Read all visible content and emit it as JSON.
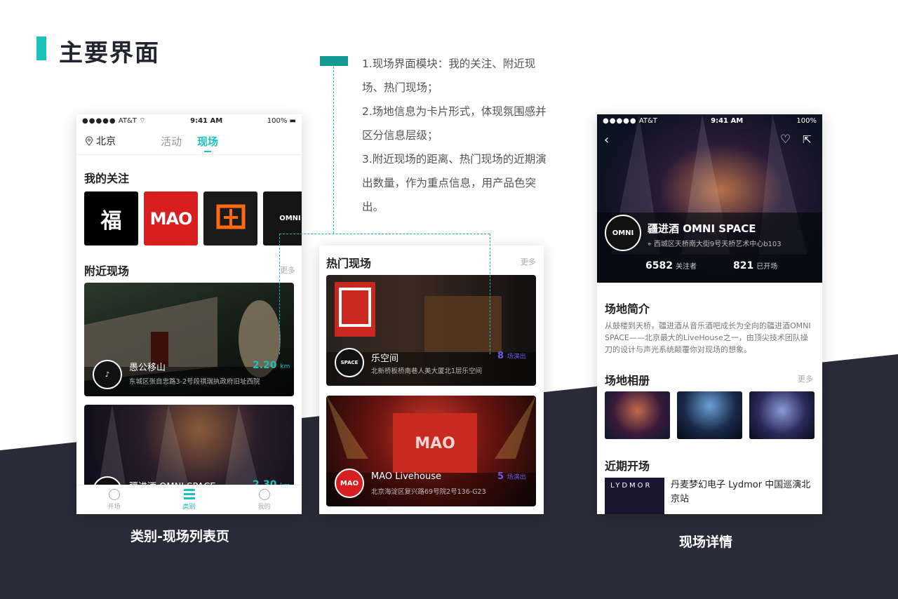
{
  "heading": {
    "title": "主要界面"
  },
  "notes": [
    "1.现场界面模块：我的关注、附近现场、热门现场；",
    "2.场地信息为卡片形式，体现氛围感并区分信息层级；",
    "3.附近现场的距离、热门现场的近期演出数量，作为重点信息，用产品色突出。"
  ],
  "colors": {
    "accent": "#1cc1bd",
    "dark_bg": "#2a2b38",
    "highlight_purple": "#6c5ce7"
  },
  "status_bar": {
    "carrier": "AT&T",
    "time": "9:41 AM",
    "battery": "100%"
  },
  "screen_list": {
    "city": "北京",
    "tabs": [
      {
        "label": "活动"
      },
      {
        "label": "现场"
      }
    ],
    "following_title": "我的关注",
    "nearby_title": "附近现场",
    "nearby_more": "更多",
    "nearby": [
      {
        "name": "愚公移山",
        "address": "东城区张自忠路3-2号段祺瑞执政府旧址西院",
        "distance": "2.20",
        "unit": "km"
      },
      {
        "name": "疆进酒 OMNI SPACE",
        "address": "",
        "distance": "2.30",
        "unit": "km"
      }
    ],
    "tabbar": [
      {
        "label": "开场"
      },
      {
        "label": "类别"
      },
      {
        "label": "我的"
      }
    ],
    "caption": "类别-现场列表页"
  },
  "screen_hot": {
    "title": "热门现场",
    "more": "更多",
    "venues": [
      {
        "name": "乐空间",
        "address": "北新桥板桥南巷人美大厦北1层乐空间",
        "count": "8",
        "unit": "场演出",
        "avatar": "SPACE"
      },
      {
        "name": "MAO Livehouse",
        "address": "北京海淀区复兴路69号院2号136-G23",
        "count": "5",
        "unit": "场演出",
        "avatar": "MAO"
      }
    ]
  },
  "screen_detail": {
    "name": "疆进酒 OMNI SPACE",
    "address": "西城区天桥南大街9号天桥艺术中心b103",
    "followers": "6582",
    "followers_label": "关注者",
    "shows": "821",
    "shows_label": "已开场",
    "intro_title": "场地简介",
    "intro_text": "从鼓楼到天桥，疆进酒从音乐酒吧成长为全向的疆进酒OMNI SPACE——北京最大的LiveHouse之一，由顶尖技术团队操刀的设计与声光系统颠覆你对现场的想象。",
    "album_title": "场地相册",
    "album_more": "更多",
    "recent_title": "近期开场",
    "recent_event": "丹麦梦幻电子 Lydmor 中国巡演北京站",
    "recent_poster_text": "LYDMOR",
    "caption": "现场详情"
  }
}
